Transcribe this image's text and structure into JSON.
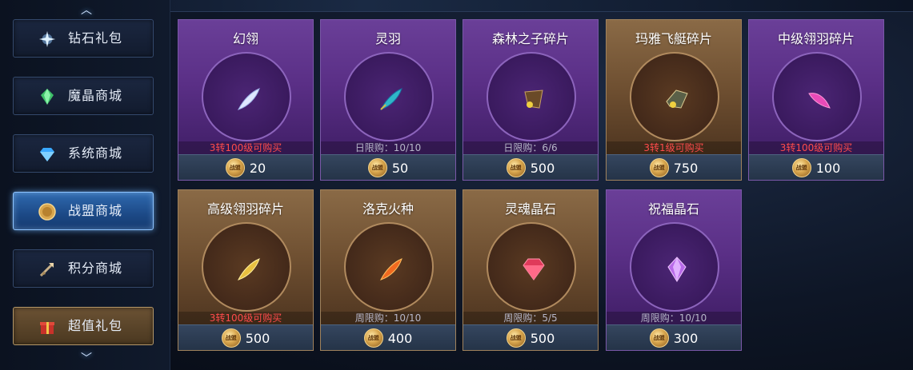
{
  "sidebar": {
    "items": [
      {
        "label": "钻石礼包",
        "icon": "diamond-sparkle-icon",
        "active": false
      },
      {
        "label": "魔晶商城",
        "icon": "green-crystal-icon",
        "active": false
      },
      {
        "label": "系统商城",
        "icon": "blue-diamond-icon",
        "active": false
      },
      {
        "label": "战盟商城",
        "icon": "alliance-coin-icon",
        "active": true
      },
      {
        "label": "积分商城",
        "icon": "points-arrow-icon",
        "active": false
      },
      {
        "label": "超值礼包",
        "icon": "gift-box-icon",
        "active": false
      }
    ],
    "scroll_up_icon": "chevron-up-icon",
    "scroll_down_icon": "chevron-down-icon"
  },
  "currency": {
    "coin_label": "战盟"
  },
  "items": [
    {
      "name": "幻翎",
      "condition": "3转100级可购买",
      "condition_color": "#ff4b4b",
      "price": "20",
      "theme": "purple",
      "icon": "white-feather-icon"
    },
    {
      "name": "灵羽",
      "condition": "日限购：10/10",
      "condition_color": "#b6b6c8",
      "price": "50",
      "theme": "purple",
      "icon": "teal-feather-icon"
    },
    {
      "name": "森林之子碎片",
      "condition": "日限购：6/6",
      "condition_color": "#b6b6c8",
      "price": "500",
      "theme": "purple",
      "icon": "forest-wings-icon"
    },
    {
      "name": "玛雅飞艇碎片",
      "condition": "3转1级可购买",
      "condition_color": "#ff4b4b",
      "price": "750",
      "theme": "brown",
      "icon": "airship-icon"
    },
    {
      "name": "中级翎羽碎片",
      "condition": "3转100级可购买",
      "condition_color": "#ff4b4b",
      "price": "100",
      "theme": "purple",
      "icon": "pink-feather-icon"
    },
    {
      "name": "高级翎羽碎片",
      "condition": "3转100级可购买",
      "condition_color": "#ff4b4b",
      "price": "500",
      "theme": "brown",
      "icon": "gold-feather-icon"
    },
    {
      "name": "洛克火种",
      "condition": "周限购：10/10",
      "condition_color": "#b6b6c8",
      "price": "400",
      "theme": "brown",
      "icon": "fire-feather-icon"
    },
    {
      "name": "灵魂晶石",
      "condition": "周限购：5/5",
      "condition_color": "#b6b6c8",
      "price": "500",
      "theme": "brown",
      "icon": "red-gem-icon"
    },
    {
      "name": "祝福晶石",
      "condition": "周限购：10/10",
      "condition_color": "#b6b6c8",
      "price": "300",
      "theme": "purple",
      "icon": "purple-crystal-icon"
    }
  ]
}
